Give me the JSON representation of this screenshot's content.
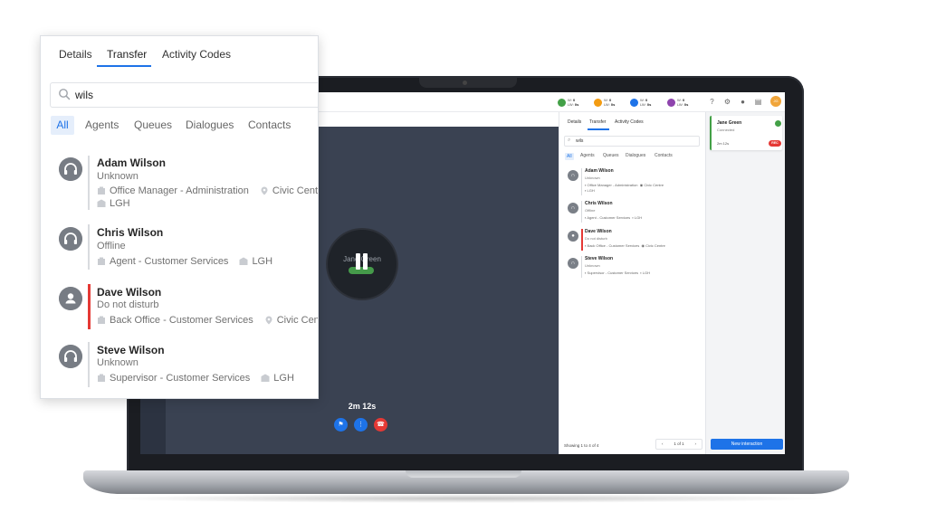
{
  "panel": {
    "tabs": [
      "Details",
      "Transfer",
      "Activity Codes"
    ],
    "active_tab": "Transfer",
    "search": {
      "value": "wils"
    },
    "filters": [
      "All",
      "Agents",
      "Queues",
      "Dialogues",
      "Contacts"
    ],
    "active_filter": "All",
    "results": [
      {
        "name": "Adam Wilson",
        "status": "Unknown",
        "role": "Office Manager - Administration",
        "location": "Civic Centre",
        "site": "LGH",
        "icon": "headset-icon"
      },
      {
        "name": "Chris Wilson",
        "status": "Offline",
        "role": "Agent - Customer Services",
        "location": "",
        "site": "LGH",
        "icon": "headset-icon"
      },
      {
        "name": "Dave Wilson",
        "status": "Do not disturb",
        "role": "Back Office - Customer Services",
        "location": "Civic Centre",
        "site": "",
        "icon": "person-icon"
      },
      {
        "name": "Steve Wilson",
        "status": "Unknown",
        "role": "Supervisor - Customer Services",
        "location": "",
        "site": "LGH",
        "icon": "headset-icon"
      }
    ]
  },
  "screen": {
    "stats": [
      {
        "code_top": "W:",
        "code_bottom": "LW:",
        "val_top": "0",
        "val_bottom": "0s",
        "color": "#43a047"
      },
      {
        "code_top": "W:",
        "code_bottom": "LW:",
        "val_top": "0",
        "val_bottom": "0s",
        "color": "#f39c12"
      },
      {
        "code_top": "W:",
        "code_bottom": "LW:",
        "val_top": "0",
        "val_bottom": "0s",
        "color": "#1e73e8"
      },
      {
        "code_top": "W:",
        "code_bottom": "LW:",
        "val_top": "0",
        "val_bottom": "0s",
        "color": "#8e44ad"
      }
    ],
    "user_initials": "JG",
    "caller_name": "Jane Green",
    "call_timer": "2m 12s",
    "mini_panel": {
      "tabs": [
        "Details",
        "Transfer",
        "Activity Codes"
      ],
      "search_value": "wils",
      "filters": [
        "All",
        "Agents",
        "Queues",
        "Dialogues",
        "Contacts"
      ],
      "showing": "Showing 1 to 4 of 4",
      "page": "1 of 1"
    },
    "interaction_card": {
      "name": "Jane Green",
      "status": "Connected",
      "time": "2m 12s",
      "rec": "REC"
    },
    "new_interaction_label": "New interaction"
  },
  "colors": {
    "accent": "#1e73e8",
    "dnd": "#e53935",
    "connected": "#43a047",
    "hangup": "#e53935"
  }
}
